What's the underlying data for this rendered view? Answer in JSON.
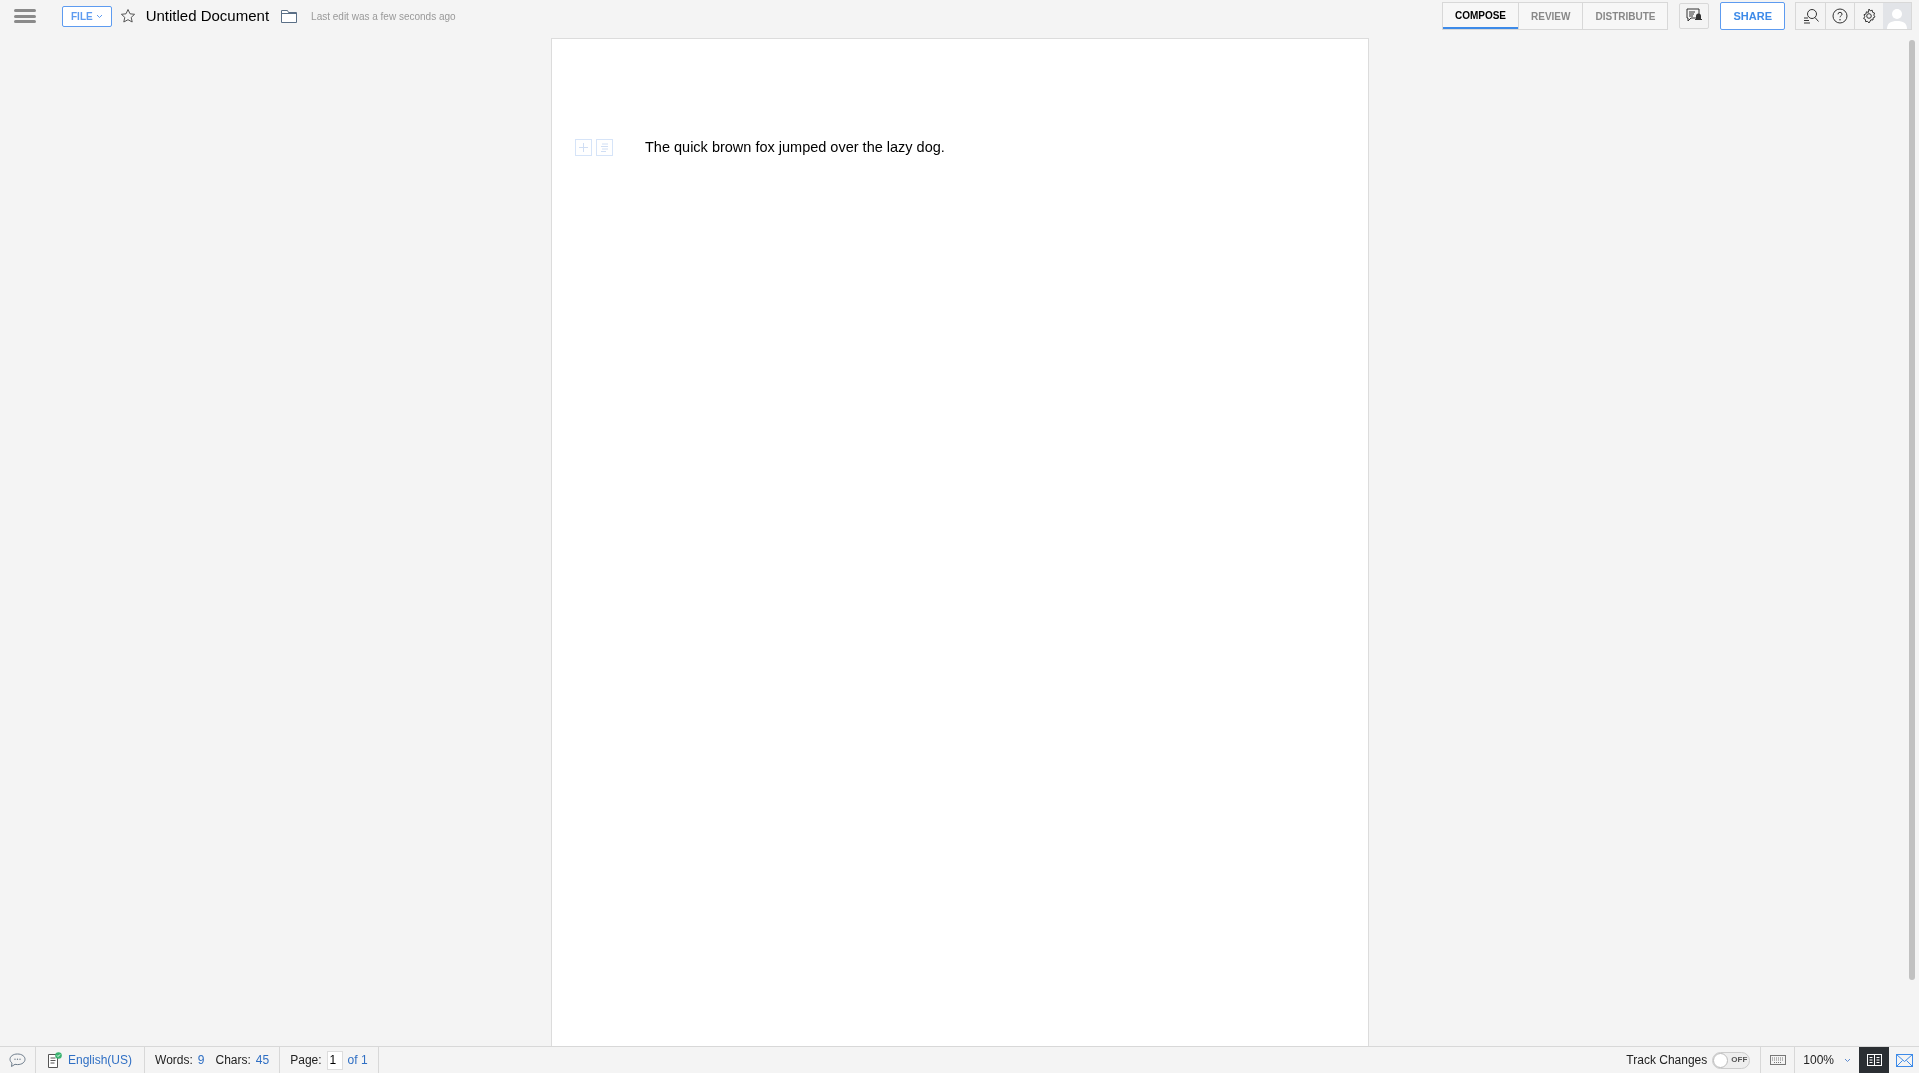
{
  "header": {
    "file_menu": "FILE",
    "starred": false,
    "title": "Untitled Document",
    "last_edit": "Last edit was a few seconds ago"
  },
  "tabs": [
    {
      "label": "COMPOSE",
      "selected": true
    },
    {
      "label": "REVIEW",
      "selected": false
    },
    {
      "label": "DISTRIBUTE",
      "selected": false
    }
  ],
  "share_button": "SHARE",
  "document": {
    "paragraphs": [
      "The quick brown fox jumped over the lazy dog."
    ]
  },
  "status_bar": {
    "language": "English(US)",
    "words_label": "Words:",
    "words": "9",
    "chars_label": "Chars:",
    "chars": "45",
    "page_label": "Page:",
    "page": "1",
    "page_total": "of 1",
    "track_changes": {
      "label": "Track Changes",
      "on": false,
      "state_label": "OFF"
    },
    "zoom": "100%"
  }
}
